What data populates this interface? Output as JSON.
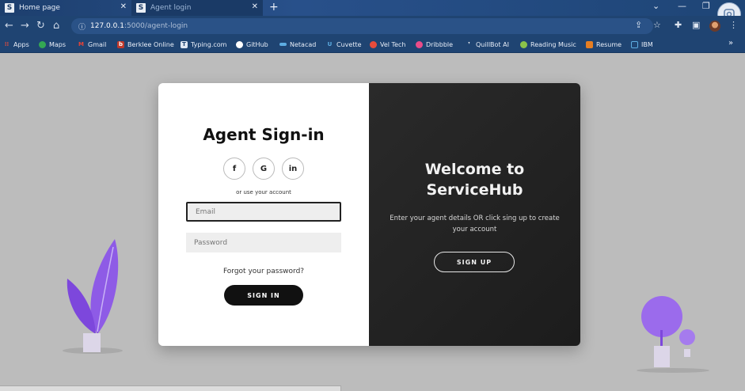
{
  "browser": {
    "tabs": [
      {
        "title": "Home page",
        "favicon": "S",
        "active": false
      },
      {
        "title": "Agent login",
        "favicon": "S",
        "active": true
      }
    ],
    "url": {
      "host": "127.0.0.1",
      "path": ":5000/agent-login"
    },
    "bookmarks": [
      {
        "label": "Apps",
        "icon": "apps-grid-icon",
        "color": "#e74c3c"
      },
      {
        "label": "Maps",
        "icon": "maps-pin-icon",
        "color": "#34a853"
      },
      {
        "label": "Gmail",
        "icon": "gmail-icon",
        "color": "#ea4335"
      },
      {
        "label": "Berklee Online",
        "icon": "berklee-icon",
        "color": "#c0392b"
      },
      {
        "label": "Typing.com",
        "icon": "typing-icon",
        "color": "#dfe7f2"
      },
      {
        "label": "GitHub",
        "icon": "github-icon",
        "color": "#ffffff"
      },
      {
        "label": "Netacad",
        "icon": "netacad-icon",
        "color": "#5dade2"
      },
      {
        "label": "Cuvette",
        "icon": "cuvette-icon",
        "color": "#5dade2"
      },
      {
        "label": "Vel Tech",
        "icon": "veltech-icon",
        "color": "#e74c3c"
      },
      {
        "label": "Dribbble",
        "icon": "dribbble-icon",
        "color": "#ea4c89"
      },
      {
        "label": "QuillBot AI",
        "icon": "quillbot-icon",
        "color": "#ffffff"
      },
      {
        "label": "Reading Music",
        "icon": "reading-music-icon",
        "color": "#8bc34a"
      },
      {
        "label": "Resume",
        "icon": "resume-icon",
        "color": "#e67e22"
      },
      {
        "label": "IBM",
        "icon": "ibm-icon",
        "color": "#5dade2"
      }
    ]
  },
  "login": {
    "title": "Agent Sign-in",
    "social": [
      "f",
      "G",
      "in"
    ],
    "alt_text": "or use your account",
    "email_placeholder": "Email",
    "password_placeholder": "Password",
    "forgot": "Forgot your password?",
    "signin_label": "SIGN IN"
  },
  "welcome": {
    "title_line1": "Welcome to",
    "title_line2": "ServiceHub",
    "text": "Enter your agent details OR click sing up to create your account",
    "signup_label": "SIGN UP"
  },
  "colors": {
    "accent_purple": "#8e5be6",
    "dark_panel": "#222222",
    "page_bg": "#bcbcbc"
  }
}
